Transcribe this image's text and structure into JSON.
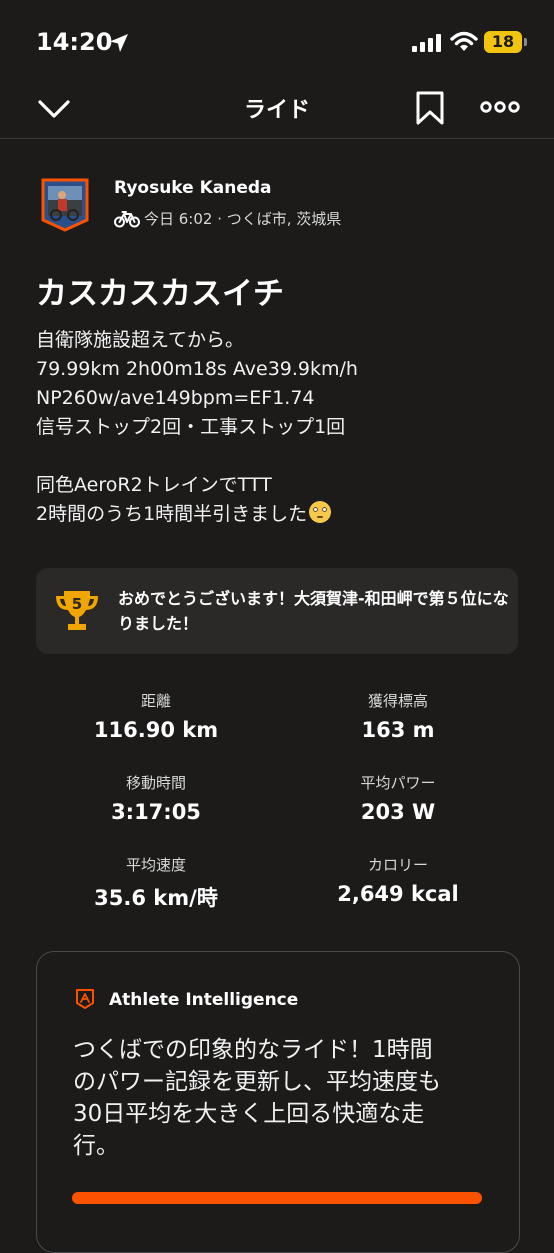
{
  "status_bar": {
    "time": "14:20",
    "battery": "18"
  },
  "nav": {
    "title": "ライド"
  },
  "athlete": {
    "name": "Ryosuke Kaneda",
    "meta": "今日 6:02 · つくば市, 茨城県"
  },
  "activity": {
    "title": "カスカスカスイチ",
    "description_lines": [
      "自衛隊施設超えてから。",
      "79.99km 2h00m18s  Ave39.9km/h",
      "NP260w/ave149bpm=EF1.74",
      "信号ストップ2回・工事ストップ1回",
      "",
      "同色AeroR2トレインでTTT",
      "2時間のうち1時間半引きました"
    ]
  },
  "achievement": {
    "rank": "5",
    "text": "おめでとうございます！大須賀津-和田岬で第５位になりました！"
  },
  "stats": [
    {
      "label": "距離",
      "value": "116.90 km"
    },
    {
      "label": "獲得標高",
      "value": "163 m"
    },
    {
      "label": "移動時間",
      "value": "3:17:05"
    },
    {
      "label": "平均パワー",
      "value": "203 W"
    },
    {
      "label": "平均速度",
      "value": "35.6 km/時"
    },
    {
      "label": "カロリー",
      "value": "2,649 kcal"
    }
  ],
  "ai_card": {
    "title": "Athlete Intelligence",
    "lines": [
      "つくばでの印象的なライド！1時間",
      "のパワー記録を更新し、平均速度も",
      "30日平均を大きく上回る快適な走",
      "行。"
    ]
  },
  "colors": {
    "accent": "#fc5200",
    "background": "#1c1b1a",
    "card": "#2a2928",
    "trophy": "#f0a500",
    "battery": "#f1c40f"
  }
}
